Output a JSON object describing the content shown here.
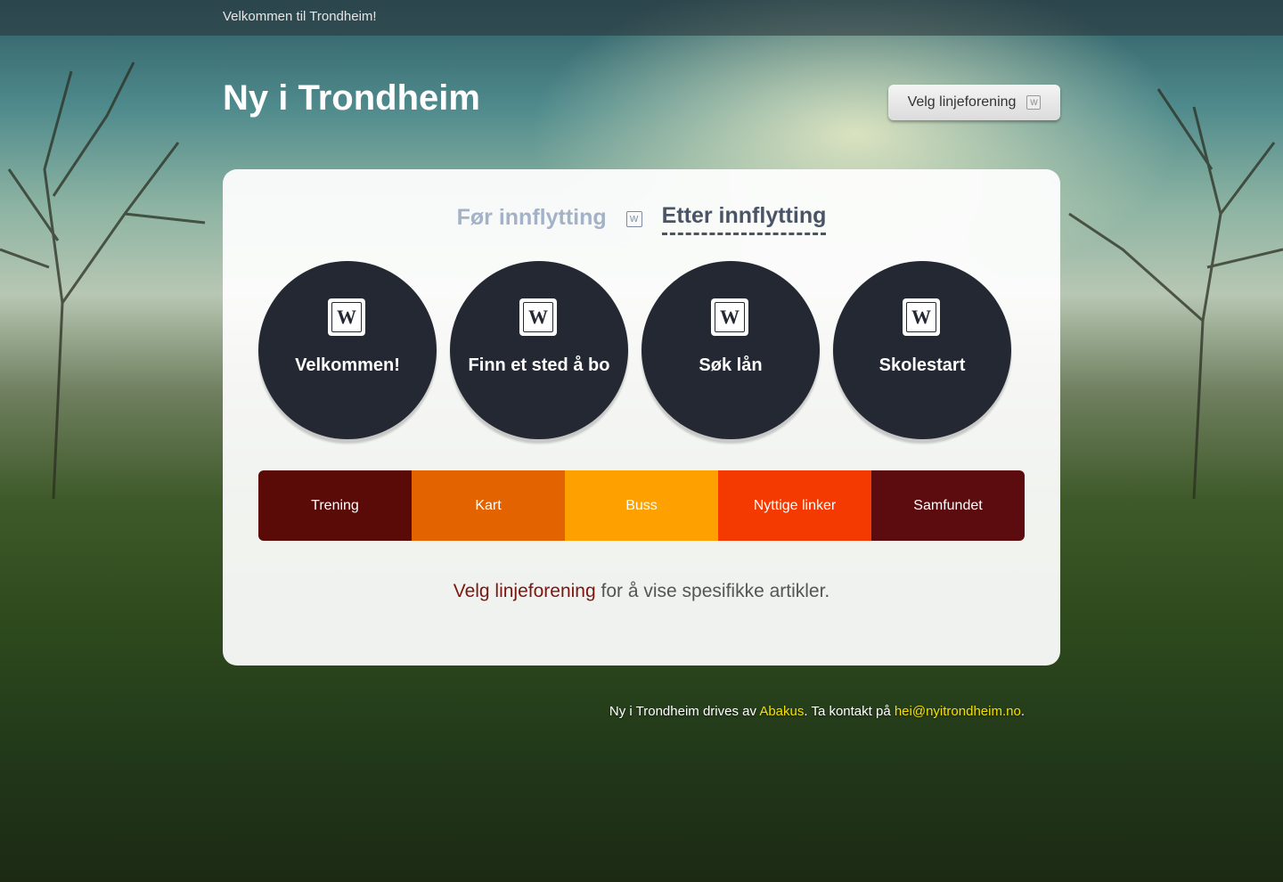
{
  "topbar": {
    "text": "Velkommen til Trondheim!"
  },
  "header": {
    "title": "Ny i Trondheim",
    "select_button": {
      "label": "Velg linjeforening",
      "icon": "abakus-logo-icon"
    }
  },
  "tabs": [
    {
      "label": "Før innflytting",
      "active": false
    },
    {
      "label": "Etter innflytting",
      "active": true
    }
  ],
  "categories": [
    {
      "label": "Velkommen!",
      "icon": "abakus-logo-icon"
    },
    {
      "label": "Finn et sted å bo",
      "icon": "abakus-logo-icon"
    },
    {
      "label": "Søk lån",
      "icon": "abakus-logo-icon"
    },
    {
      "label": "Skolestart",
      "icon": "abakus-logo-icon"
    }
  ],
  "colorbar": [
    {
      "label": "Trening",
      "color": "#5a0b08"
    },
    {
      "label": "Kart",
      "color": "#e36300"
    },
    {
      "label": "Buss",
      "color": "#fea000"
    },
    {
      "label": "Nyttige linker",
      "color": "#f43a00"
    },
    {
      "label": "Samfundet",
      "color": "#5c0c0e"
    }
  ],
  "note": {
    "link": "Velg linjeforening",
    "text": " for å vise spesifikke artikler."
  },
  "footer": {
    "prefix": "Ny i Trondheim drives av ",
    "org": "Abakus",
    "middle": ". Ta kontakt på ",
    "email": "hei@nyitrondheim.no",
    "suffix": "."
  }
}
